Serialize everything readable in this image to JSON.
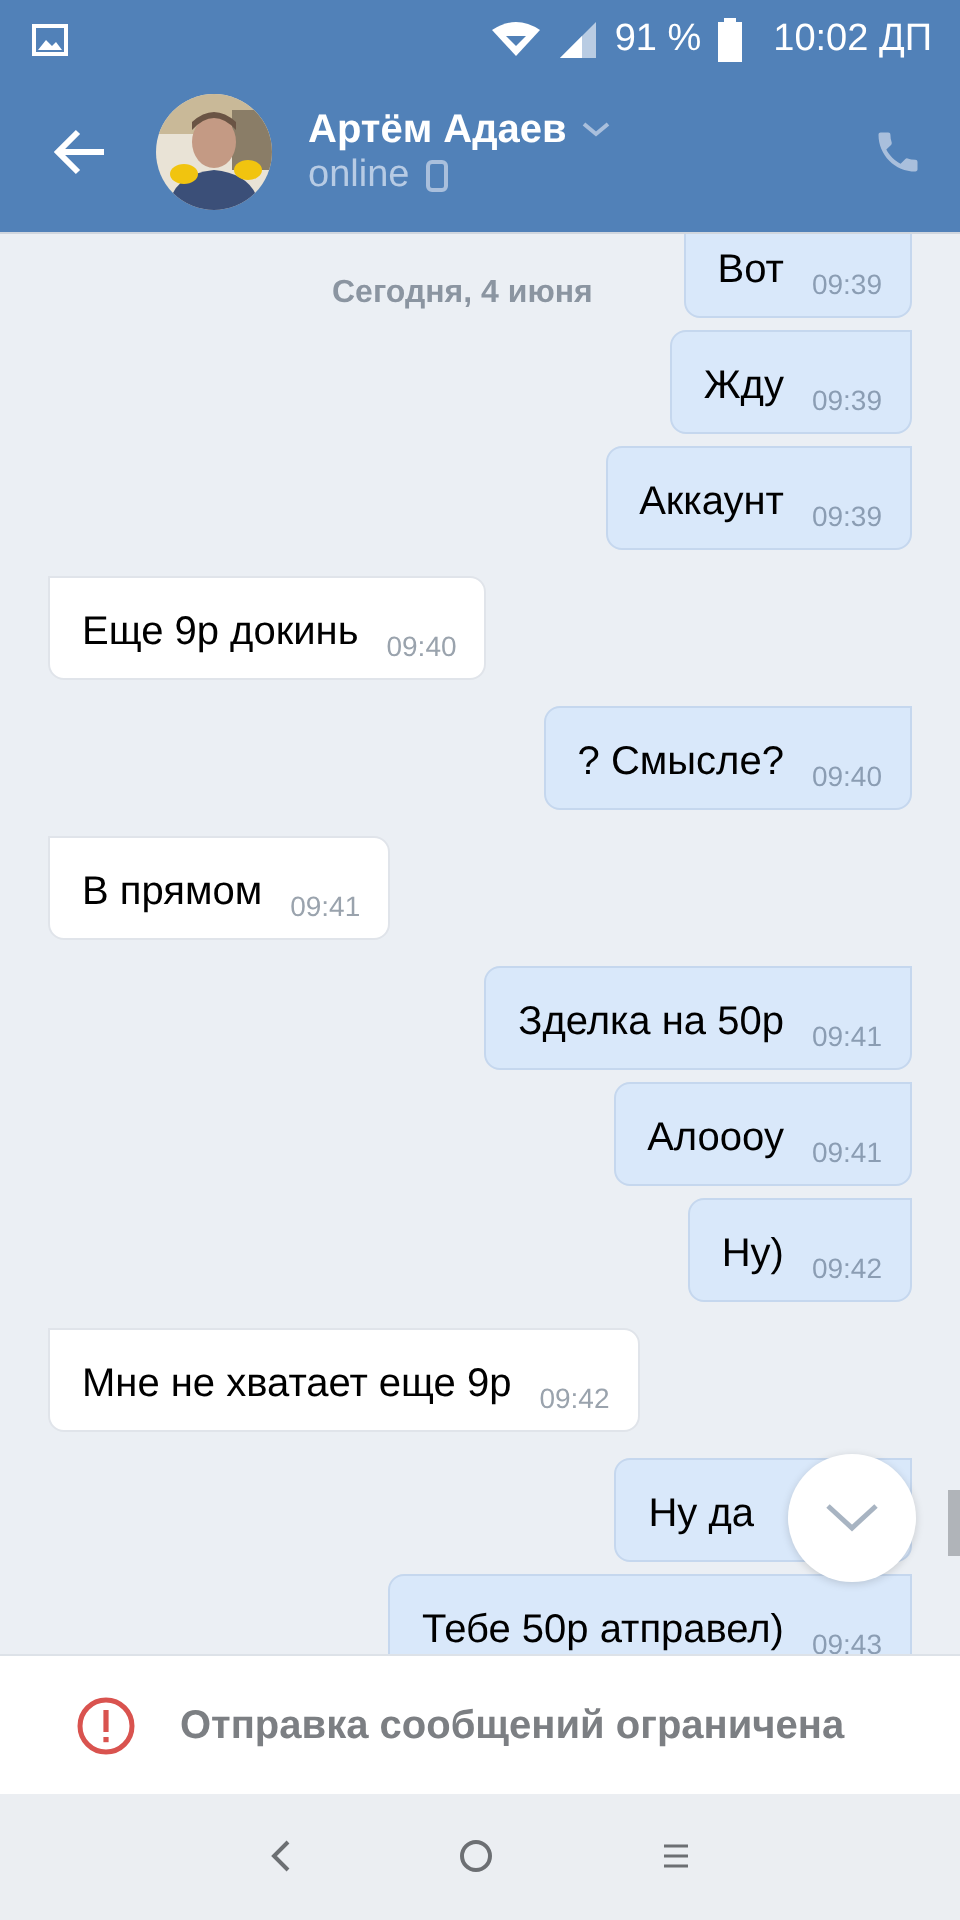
{
  "status_bar": {
    "battery": "91 %",
    "time": "10:02 ДП"
  },
  "header": {
    "name": "Артём Адаев",
    "presence": "online"
  },
  "date_label": "Сегодня, 4 июня",
  "messages": [
    {
      "text": "Вот",
      "time": "09:39",
      "outgoing": true
    },
    {
      "text": "Жду",
      "time": "09:39",
      "outgoing": true
    },
    {
      "text": "Аккаунт",
      "time": "09:39",
      "outgoing": true
    },
    {
      "text": "Еще 9р докинь",
      "time": "09:40",
      "outgoing": false
    },
    {
      "text": "? Смысле?",
      "time": "09:40",
      "outgoing": true
    },
    {
      "text": "В прямом",
      "time": "09:41",
      "outgoing": false
    },
    {
      "text": "Зделка на 50р",
      "time": "09:41",
      "outgoing": true
    },
    {
      "text": "Алоооу",
      "time": "09:41",
      "outgoing": true
    },
    {
      "text": "Ну)",
      "time": "09:42",
      "outgoing": true
    },
    {
      "text": "Мне не хватает еще 9р",
      "time": "09:42",
      "outgoing": false
    },
    {
      "text": "Ну да",
      "outgoing": true
    },
    {
      "text": "Тебе 50р атправел)",
      "time": "09:43",
      "outgoing": true
    }
  ],
  "notice": "Отправка сообщений ограничена"
}
